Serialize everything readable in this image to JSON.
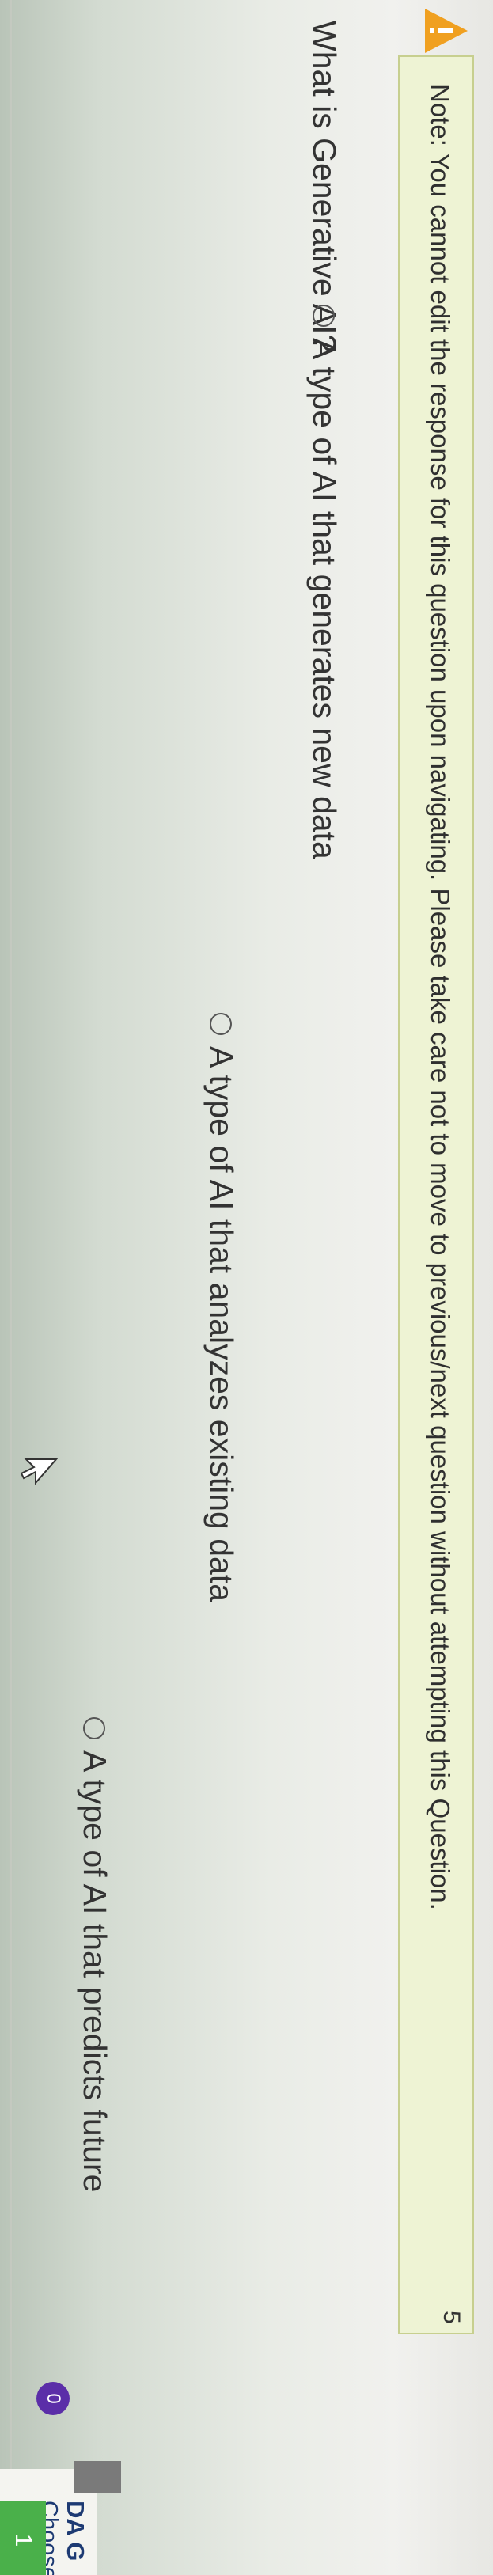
{
  "notice": {
    "text": "Note: You cannot edit the response for this question upon navigating. Please take care not to move to previous/next question without attempting this Question."
  },
  "question_number": "5",
  "question": {
    "text": "What is Generative AI?",
    "options": [
      {
        "label": "A type of AI that generates new data"
      },
      {
        "label": "A type of AI that analyzes existing data"
      },
      {
        "label": "A type of AI that predicts future"
      }
    ]
  },
  "score_badge": "0",
  "side_panel": {
    "title": "DA G",
    "subtitle": "Choose a",
    "button": "1"
  },
  "colors": {
    "notice_bg": "#eef3d4",
    "notice_border": "#c7cf8f",
    "warning": "#f0a020",
    "badge": "#5b2ea8",
    "button": "#4ab04a"
  }
}
